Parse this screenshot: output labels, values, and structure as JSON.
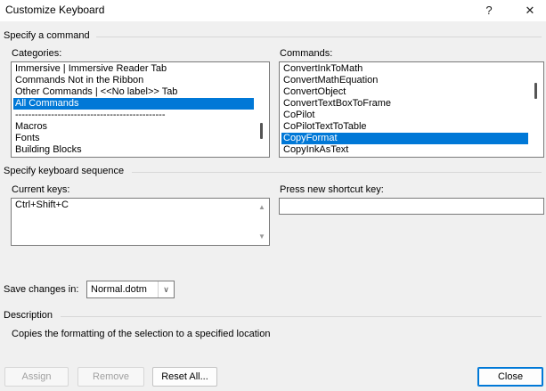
{
  "window": {
    "title": "Customize Keyboard",
    "help": "?",
    "close": "✕"
  },
  "specify_command": {
    "group_label": "Specify a command",
    "categories_label": "Categories:",
    "categories": [
      "Immersive | Immersive Reader Tab",
      "Commands Not in the Ribbon",
      "Other Commands | <<No label>> Tab",
      "All Commands",
      "----------------------------------------------",
      "Macros",
      "Fonts",
      "Building Blocks"
    ],
    "categories_selected": "All Commands",
    "commands_label": "Commands:",
    "commands": [
      "ConvertInkToMath",
      "ConvertMathEquation",
      "ConvertObject",
      "ConvertTextBoxToFrame",
      "CoPilot",
      "CoPilotTextToTable",
      "CopyFormat",
      "CopyInkAsText"
    ],
    "commands_selected": "CopyFormat"
  },
  "keyboard_sequence": {
    "group_label": "Specify keyboard sequence",
    "current_keys_label": "Current keys:",
    "current_keys": [
      "Ctrl+Shift+C"
    ],
    "new_shortcut_label": "Press new shortcut key:",
    "new_shortcut_value": ""
  },
  "save_changes": {
    "label": "Save changes in:",
    "value": "Normal.dotm"
  },
  "description": {
    "group_label": "Description",
    "text": "Copies the formatting of the selection to a specified location"
  },
  "buttons": {
    "assign": "Assign",
    "remove": "Remove",
    "reset_all": "Reset All...",
    "close": "Close"
  },
  "colors": {
    "selection": "#0078d7",
    "background": "#f0f0f0"
  }
}
